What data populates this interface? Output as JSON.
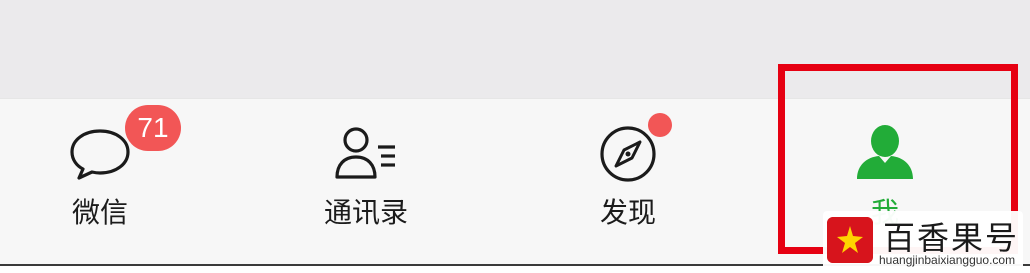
{
  "tab_bar": {
    "tabs": [
      {
        "label": "微信",
        "icon": "chat-bubble-icon",
        "badge": "71"
      },
      {
        "label": "通讯录",
        "icon": "contacts-icon"
      },
      {
        "label": "发现",
        "icon": "compass-icon",
        "has_dot": true
      },
      {
        "label": "我",
        "icon": "person-icon",
        "active": true
      }
    ]
  },
  "watermark": {
    "title": "百香果号",
    "url": "huangjinbaixiangguo.com"
  },
  "colors": {
    "active_green": "#22ac38",
    "badge_red": "#f25656",
    "highlight_red": "#e60012"
  }
}
